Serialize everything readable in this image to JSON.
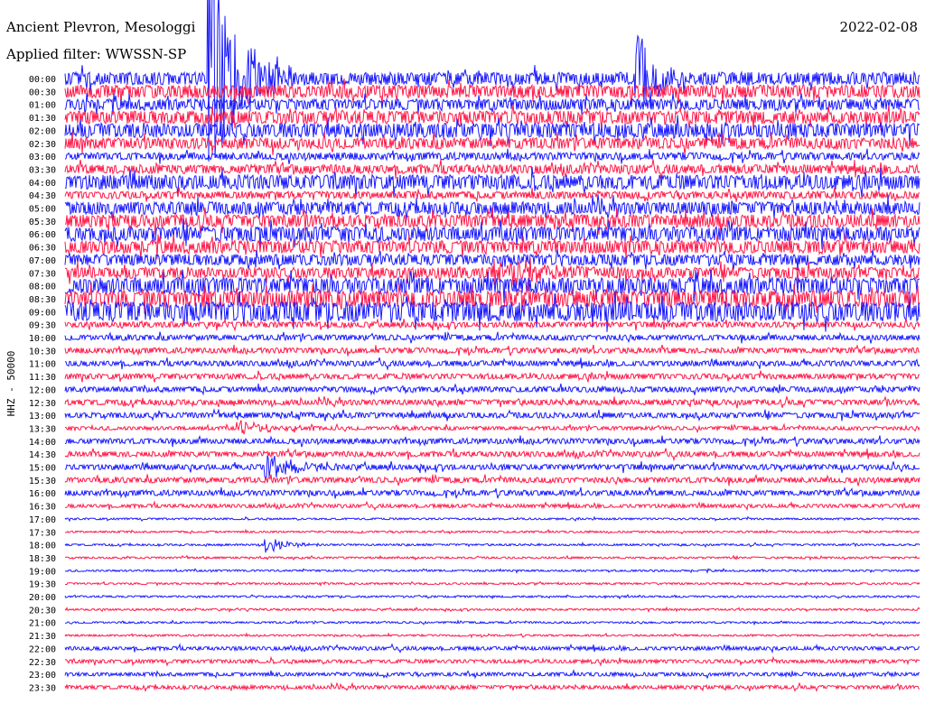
{
  "header": {
    "station": "Ancient Plevron, Mesologgi",
    "filter_label": "Applied filter: WWSSN-SP",
    "date": "2022-02-08"
  },
  "chart_data": {
    "type": "line",
    "title": "Ancient Plevron, Mesologgi",
    "date": "2022-02-08",
    "filter": "WWSSN-SP",
    "ylabel": "HHZ - 50000",
    "row_labels": [
      "00:00",
      "00:30",
      "01:00",
      "01:30",
      "02:00",
      "02:30",
      "03:00",
      "03:30",
      "04:00",
      "04:30",
      "05:00",
      "05:30",
      "06:00",
      "06:30",
      "07:00",
      "07:30",
      "08:00",
      "08:30",
      "09:00",
      "09:30",
      "10:00",
      "10:30",
      "11:00",
      "11:30",
      "12:00",
      "12:30",
      "13:00",
      "13:30",
      "14:00",
      "14:30",
      "15:00",
      "15:30",
      "16:00",
      "16:30",
      "17:00",
      "17:30",
      "18:00",
      "18:30",
      "19:00",
      "19:30",
      "20:00",
      "20:30",
      "21:00",
      "21:30",
      "22:00",
      "22:30",
      "23:00",
      "23:30"
    ],
    "colors": [
      "#1a1aff",
      "#ff1a4a"
    ],
    "noise_level": [
      7,
      7,
      6,
      7,
      8,
      6,
      4,
      5,
      8,
      4,
      7,
      7,
      8,
      7,
      6,
      6,
      9,
      9,
      11,
      3,
      3,
      3,
      3,
      3,
      3,
      3,
      3,
      2,
      3,
      3,
      3,
      3,
      3,
      2,
      1,
      1,
      1,
      1,
      1,
      1,
      1,
      1,
      1,
      1,
      2,
      2,
      2,
      2
    ],
    "events": [
      {
        "row": 0,
        "minute": 5,
        "amplitude": 140,
        "duration_min": 3
      },
      {
        "row": 0,
        "minute": 20,
        "amplitude": 60,
        "duration_min": 2
      },
      {
        "row": 15,
        "minute": 15,
        "amplitude": 14,
        "duration_min": 5
      },
      {
        "row": 30,
        "minute": 7,
        "amplitude": 16,
        "duration_min": 3
      },
      {
        "row": 36,
        "minute": 7,
        "amplitude": 10,
        "duration_min": 2
      },
      {
        "row": 27,
        "minute": 6,
        "amplitude": 9,
        "duration_min": 3
      }
    ]
  }
}
